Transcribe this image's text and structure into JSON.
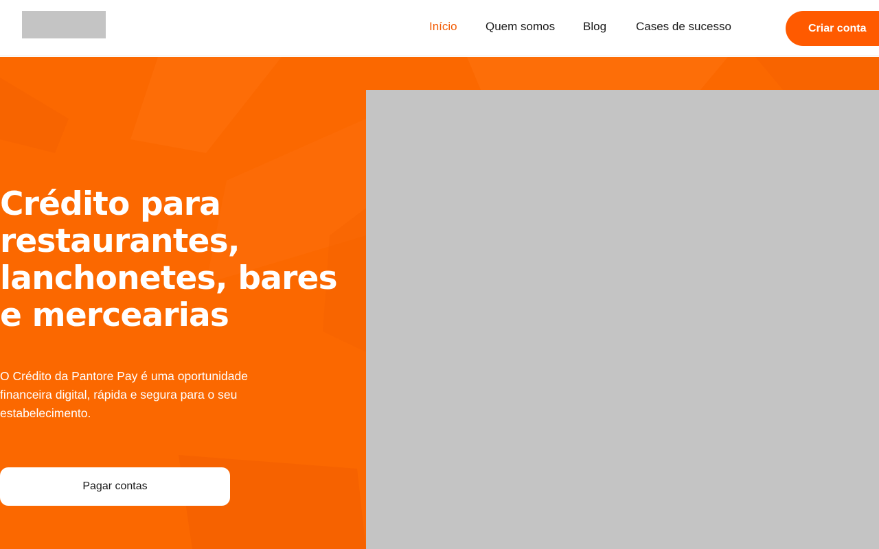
{
  "header": {
    "nav": [
      {
        "label": "Início",
        "active": true
      },
      {
        "label": "Quem somos",
        "active": false
      },
      {
        "label": "Blog",
        "active": false
      },
      {
        "label": "Cases de sucesso",
        "active": false
      }
    ],
    "cta_label": "Criar conta"
  },
  "hero": {
    "title": "Crédito para restaurantes, lanchonetes, bares e mercearias",
    "subtitle": "O Crédito da Pantore Pay é uma oportunidade financeira digital, rápida e segura para o seu estabelecimento.",
    "button_label": "Pagar contas"
  },
  "colors": {
    "accent": "#f25c05",
    "cta_background": "#ff5a00",
    "hero_background": "#fb6800",
    "placeholder": "#c4c4c4"
  }
}
